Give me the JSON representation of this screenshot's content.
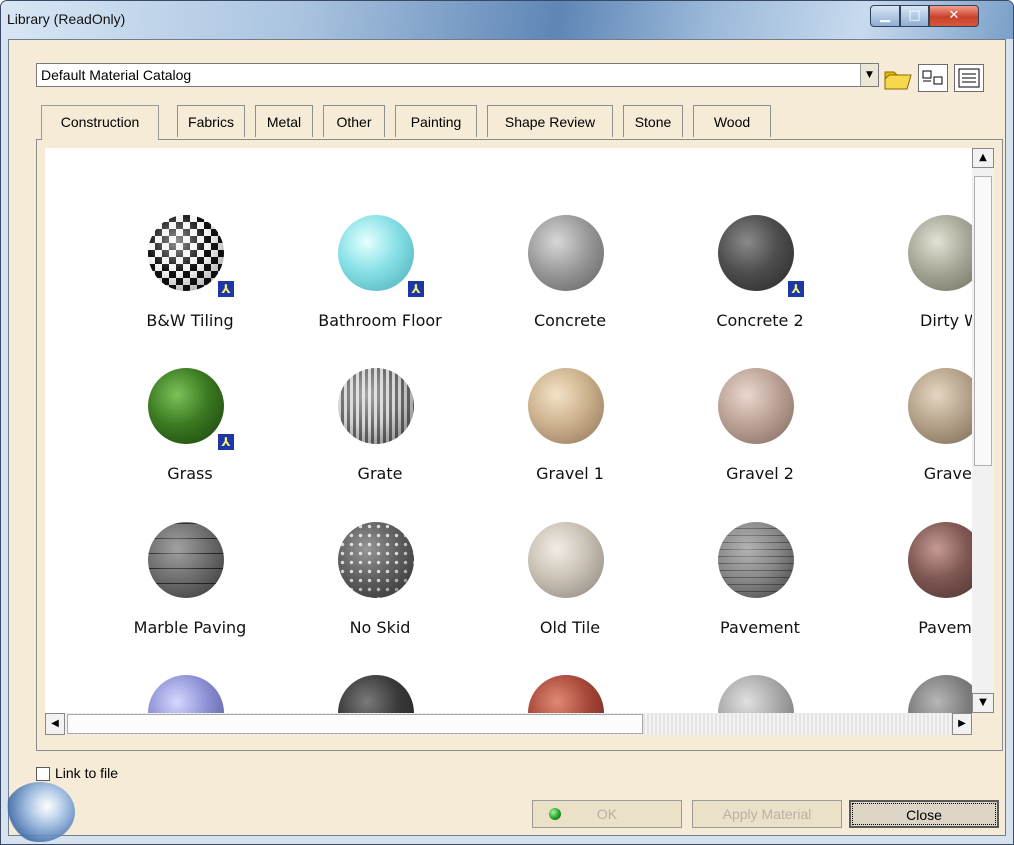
{
  "window": {
    "title": "Library (ReadOnly)"
  },
  "catalog": {
    "selected": "Default Material Catalog"
  },
  "tabs": [
    {
      "label": "Construction",
      "active": true
    },
    {
      "label": "Fabrics",
      "active": false
    },
    {
      "label": "Metal",
      "active": false
    },
    {
      "label": "Other",
      "active": false
    },
    {
      "label": "Painting",
      "active": false
    },
    {
      "label": "Shape Review",
      "active": false
    },
    {
      "label": "Stone",
      "active": false
    },
    {
      "label": "Wood",
      "active": false
    }
  ],
  "materials": [
    {
      "label": "B&W Tiling",
      "linked": true
    },
    {
      "label": "Bathroom Floor",
      "linked": true
    },
    {
      "label": "Concrete",
      "linked": false
    },
    {
      "label": "Concrete 2",
      "linked": true
    },
    {
      "label": "Dirty W",
      "linked": false
    },
    {
      "label": "Grass",
      "linked": true
    },
    {
      "label": "Grate",
      "linked": false
    },
    {
      "label": "Gravel 1",
      "linked": false
    },
    {
      "label": "Gravel 2",
      "linked": false
    },
    {
      "label": "Gravel",
      "linked": false
    },
    {
      "label": "Marble Paving",
      "linked": false
    },
    {
      "label": "No Skid",
      "linked": false
    },
    {
      "label": "Old Tile",
      "linked": false
    },
    {
      "label": "Pavement",
      "linked": false
    },
    {
      "label": "Paveme",
      "linked": false
    }
  ],
  "link_to_file": {
    "label": "Link to file",
    "checked": false
  },
  "buttons": {
    "ok": "OK",
    "apply": "Apply Material",
    "close": "Close"
  }
}
